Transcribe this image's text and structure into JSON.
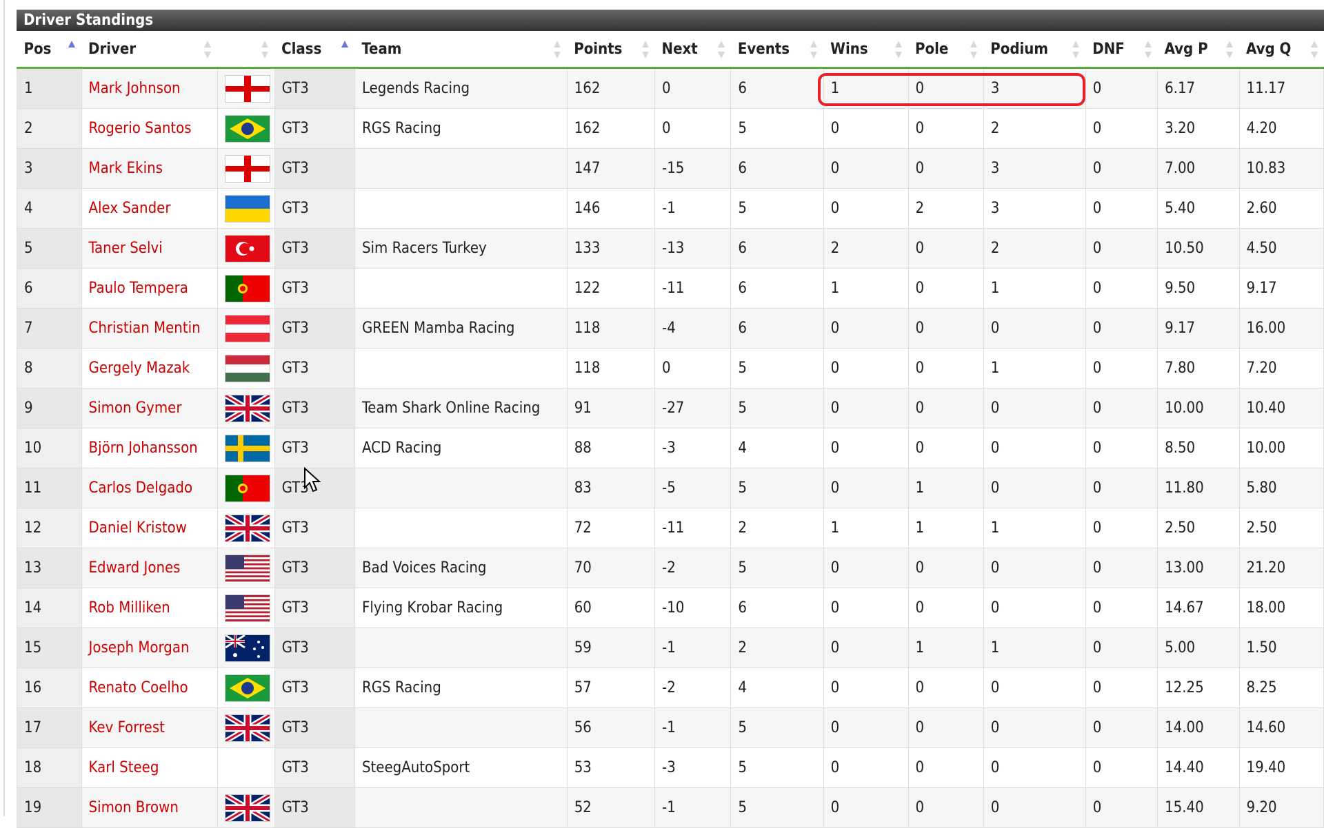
{
  "title": "Driver Standings",
  "columns": [
    {
      "label": "Pos",
      "sort": "asc"
    },
    {
      "label": "Driver",
      "sort": "none"
    },
    {
      "label": "",
      "sort": "none"
    },
    {
      "label": "Class",
      "sort": "asc"
    },
    {
      "label": "Team",
      "sort": "none"
    },
    {
      "label": "Points",
      "sort": "none"
    },
    {
      "label": "Next",
      "sort": "none"
    },
    {
      "label": "Events",
      "sort": "none"
    },
    {
      "label": "Wins",
      "sort": "none"
    },
    {
      "label": "Pole",
      "sort": "none"
    },
    {
      "label": "Podium",
      "sort": "none"
    },
    {
      "label": "DNF",
      "sort": "none"
    },
    {
      "label": "Avg P",
      "sort": "none"
    },
    {
      "label": "Avg Q",
      "sort": "none"
    }
  ],
  "rows": [
    {
      "pos": "1",
      "driver": "Mark Johnson",
      "flag": "england",
      "class": "GT3",
      "team": "Legends Racing",
      "points": "162",
      "next": "0",
      "events": "6",
      "wins": "1",
      "pole": "0",
      "podium": "3",
      "dnf": "0",
      "avgp": "6.17",
      "avgq": "11.17"
    },
    {
      "pos": "2",
      "driver": "Rogerio Santos",
      "flag": "brazil",
      "class": "GT3",
      "team": "RGS Racing",
      "points": "162",
      "next": "0",
      "events": "5",
      "wins": "0",
      "pole": "0",
      "podium": "2",
      "dnf": "0",
      "avgp": "3.20",
      "avgq": "4.20"
    },
    {
      "pos": "3",
      "driver": "Mark Ekins",
      "flag": "england",
      "class": "GT3",
      "team": "",
      "points": "147",
      "next": "-15",
      "events": "6",
      "wins": "0",
      "pole": "0",
      "podium": "3",
      "dnf": "0",
      "avgp": "7.00",
      "avgq": "10.83"
    },
    {
      "pos": "4",
      "driver": "Alex Sander",
      "flag": "ukraine",
      "class": "GT3",
      "team": "",
      "points": "146",
      "next": "-1",
      "events": "5",
      "wins": "0",
      "pole": "2",
      "podium": "3",
      "dnf": "0",
      "avgp": "5.40",
      "avgq": "2.60"
    },
    {
      "pos": "5",
      "driver": "Taner Selvi",
      "flag": "turkey",
      "class": "GT3",
      "team": "Sim Racers Turkey",
      "points": "133",
      "next": "-13",
      "events": "6",
      "wins": "2",
      "pole": "0",
      "podium": "2",
      "dnf": "0",
      "avgp": "10.50",
      "avgq": "4.50"
    },
    {
      "pos": "6",
      "driver": "Paulo Tempera",
      "flag": "portugal",
      "class": "GT3",
      "team": "",
      "points": "122",
      "next": "-11",
      "events": "6",
      "wins": "1",
      "pole": "0",
      "podium": "1",
      "dnf": "0",
      "avgp": "9.50",
      "avgq": "9.17"
    },
    {
      "pos": "7",
      "driver": "Christian Mentin",
      "flag": "austria",
      "class": "GT3",
      "team": "GREEN Mamba Racing",
      "points": "118",
      "next": "-4",
      "events": "6",
      "wins": "0",
      "pole": "0",
      "podium": "0",
      "dnf": "0",
      "avgp": "9.17",
      "avgq": "16.00"
    },
    {
      "pos": "8",
      "driver": "Gergely Mazak",
      "flag": "hungary",
      "class": "GT3",
      "team": "",
      "points": "118",
      "next": "0",
      "events": "5",
      "wins": "0",
      "pole": "0",
      "podium": "1",
      "dnf": "0",
      "avgp": "7.80",
      "avgq": "7.20"
    },
    {
      "pos": "9",
      "driver": "Simon Gymer",
      "flag": "uk",
      "class": "GT3",
      "team": "Team Shark Online Racing",
      "points": "91",
      "next": "-27",
      "events": "5",
      "wins": "0",
      "pole": "0",
      "podium": "0",
      "dnf": "0",
      "avgp": "10.00",
      "avgq": "10.40"
    },
    {
      "pos": "10",
      "driver": "Björn Johansson",
      "flag": "sweden",
      "class": "GT3",
      "team": "ACD Racing",
      "points": "88",
      "next": "-3",
      "events": "4",
      "wins": "0",
      "pole": "0",
      "podium": "0",
      "dnf": "0",
      "avgp": "8.50",
      "avgq": "10.00"
    },
    {
      "pos": "11",
      "driver": "Carlos Delgado",
      "flag": "portugal",
      "class": "GT3",
      "team": "",
      "points": "83",
      "next": "-5",
      "events": "5",
      "wins": "0",
      "pole": "1",
      "podium": "0",
      "dnf": "0",
      "avgp": "11.80",
      "avgq": "5.80"
    },
    {
      "pos": "12",
      "driver": "Daniel Kristow",
      "flag": "uk",
      "class": "GT3",
      "team": "",
      "points": "72",
      "next": "-11",
      "events": "2",
      "wins": "1",
      "pole": "1",
      "podium": "1",
      "dnf": "0",
      "avgp": "2.50",
      "avgq": "2.50"
    },
    {
      "pos": "13",
      "driver": "Edward Jones",
      "flag": "usa",
      "class": "GT3",
      "team": "Bad Voices Racing",
      "points": "70",
      "next": "-2",
      "events": "5",
      "wins": "0",
      "pole": "0",
      "podium": "0",
      "dnf": "0",
      "avgp": "13.00",
      "avgq": "21.20"
    },
    {
      "pos": "14",
      "driver": "Rob Milliken",
      "flag": "usa",
      "class": "GT3",
      "team": "Flying Krobar Racing",
      "points": "60",
      "next": "-10",
      "events": "6",
      "wins": "0",
      "pole": "0",
      "podium": "0",
      "dnf": "0",
      "avgp": "14.67",
      "avgq": "18.00"
    },
    {
      "pos": "15",
      "driver": "Joseph Morgan",
      "flag": "australia",
      "class": "GT3",
      "team": "",
      "points": "59",
      "next": "-1",
      "events": "2",
      "wins": "0",
      "pole": "1",
      "podium": "1",
      "dnf": "0",
      "avgp": "5.00",
      "avgq": "1.50"
    },
    {
      "pos": "16",
      "driver": "Renato Coelho",
      "flag": "brazil",
      "class": "GT3",
      "team": "RGS Racing",
      "points": "57",
      "next": "-2",
      "events": "4",
      "wins": "0",
      "pole": "0",
      "podium": "0",
      "dnf": "0",
      "avgp": "12.25",
      "avgq": "8.25"
    },
    {
      "pos": "17",
      "driver": "Kev Forrest",
      "flag": "uk",
      "class": "GT3",
      "team": "",
      "points": "56",
      "next": "-1",
      "events": "5",
      "wins": "0",
      "pole": "0",
      "podium": "0",
      "dnf": "0",
      "avgp": "14.00",
      "avgq": "14.60"
    },
    {
      "pos": "18",
      "driver": "Karl Steeg",
      "flag": "",
      "class": "GT3",
      "team": "SteegAutoSport",
      "points": "53",
      "next": "-3",
      "events": "5",
      "wins": "0",
      "pole": "0",
      "podium": "0",
      "dnf": "0",
      "avgp": "14.40",
      "avgq": "19.40"
    },
    {
      "pos": "19",
      "driver": "Simon Brown",
      "flag": "uk",
      "class": "GT3",
      "team": "",
      "points": "52",
      "next": "-1",
      "events": "5",
      "wins": "0",
      "pole": "0",
      "podium": "0",
      "dnf": "0",
      "avgp": "15.40",
      "avgq": "9.20"
    }
  ],
  "colors": {
    "driver_link": "#cc0000",
    "header_rule": "#5aad3c",
    "highlight": "#e8202a",
    "sort_active": "#6677dd"
  }
}
